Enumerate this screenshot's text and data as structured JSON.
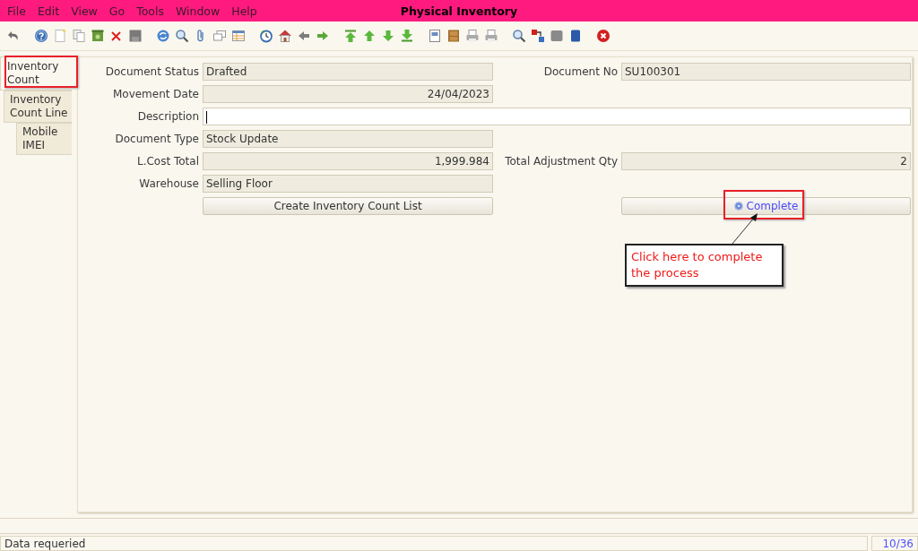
{
  "window": {
    "title": "Physical Inventory"
  },
  "menu": [
    "File",
    "Edit",
    "View",
    "Go",
    "Tools",
    "Window",
    "Help"
  ],
  "tabs": [
    {
      "label": "Inventory Count",
      "selected": true
    },
    {
      "label": "Inventory Count Line",
      "selected": false
    },
    {
      "label": "Mobile IMEI",
      "selected": false
    }
  ],
  "form": {
    "rows": [
      {
        "left": {
          "label": "Document Status",
          "value": "Drafted",
          "kind": "readonly"
        },
        "right": {
          "label": "Document No",
          "value": "SU100301",
          "kind": "readonly"
        }
      },
      {
        "left": {
          "label": "Movement Date",
          "value": "24/04/2023",
          "kind": "number"
        }
      },
      {
        "left": {
          "label": "Description",
          "kind": "input"
        }
      },
      {
        "left": {
          "label": "Document Type",
          "value": "Stock Update",
          "kind": "readonly"
        }
      },
      {
        "left": {
          "label": "L.Cost Total",
          "value": "1,999.984",
          "kind": "number"
        },
        "right": {
          "label": "Total Adjustment Qty",
          "value": "2",
          "kind": "number"
        }
      },
      {
        "left": {
          "label": "Warehouse",
          "value": "Selling Floor",
          "kind": "readonly"
        }
      }
    ],
    "buttons": [
      {
        "label": "Create Inventory Count List",
        "kind": "plain"
      },
      {
        "label": "Complete",
        "kind": "action"
      }
    ]
  },
  "annotation": {
    "text": "Click here to complete the process"
  },
  "status_bar": {
    "message": "Data requeried",
    "record": "10/36"
  }
}
